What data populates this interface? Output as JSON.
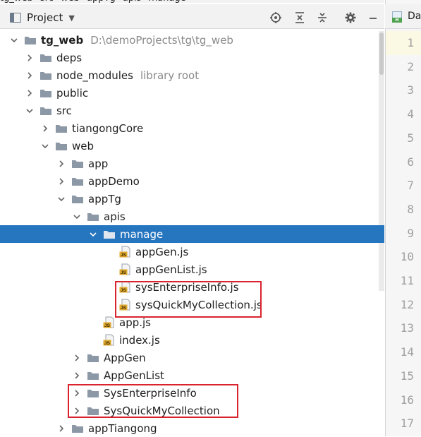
{
  "breadcrumb": [
    "tg_web",
    "src",
    "web",
    "appTg",
    "apis",
    "manage"
  ],
  "toolbar": {
    "project_label": "Project",
    "icons": [
      "locate-icon",
      "expand-all-icon",
      "collapse-all-icon",
      "gear-icon",
      "minimize-icon"
    ]
  },
  "editor": {
    "tab_label": "Da",
    "line_numbers": [
      "1",
      "2",
      "3",
      "4",
      "5",
      "6",
      "7",
      "8",
      "9",
      "10",
      "11",
      "12",
      "13",
      "14",
      "15",
      "16",
      "17"
    ]
  },
  "tree": {
    "root": {
      "name": "tg_web",
      "path": "D:\\demoProjects\\tg\\tg_web"
    },
    "deps": "deps",
    "node_modules": {
      "name": "node_modules",
      "hint": "library root"
    },
    "public": "public",
    "src": "src",
    "tiangongCore": "tiangongCore",
    "web": "web",
    "app": "app",
    "appDemo": "appDemo",
    "appTg": "appTg",
    "apis": "apis",
    "manage": "manage",
    "appGen_js": "appGen.js",
    "appGenList_js": "appGenList.js",
    "sysEnterpriseInfo_js": "sysEnterpriseInfo.js",
    "sysQuickMyCollection_js": "sysQuickMyCollection.js",
    "app_js": "app.js",
    "index_js": "index.js",
    "AppGen": "AppGen",
    "AppGenList": "AppGenList",
    "SysEnterpriseInfo": "SysEnterpriseInfo",
    "SysQuickMyCollection": "SysQuickMyCollection",
    "appTiangong": "appTiangong"
  },
  "colors": {
    "selection": "#2675bf",
    "folder": "#8c98a6",
    "js_badge": "#e0a82e",
    "highlight_box": "#d9232f"
  }
}
